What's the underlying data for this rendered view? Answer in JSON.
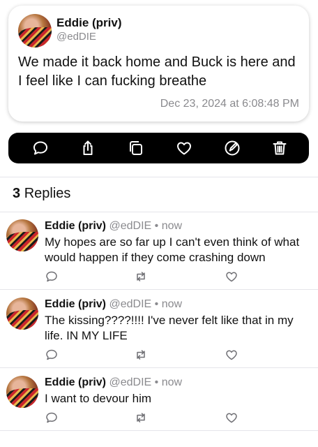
{
  "post": {
    "author_name": "Eddie (priv)",
    "author_handle": "@edDIE",
    "text": "We made it back home and Buck is here and I feel like I can fucking breathe",
    "timestamp": "Dec 23, 2024 at 6:08:48 PM"
  },
  "actionbar": {
    "icons": [
      "comment-icon",
      "share-icon",
      "copy-icon",
      "like-icon",
      "edit-icon",
      "trash-icon"
    ]
  },
  "replies_header": {
    "count": "3",
    "label": "Replies"
  },
  "replies": [
    {
      "author_name": "Eddie (priv)",
      "author_handle": "@edDIE",
      "separator": "•",
      "time": "now",
      "text": "My hopes are so far up I can't even think of what would happen if they come crashing down"
    },
    {
      "author_name": "Eddie (priv)",
      "author_handle": "@edDIE",
      "separator": "•",
      "time": "now",
      "text": "The kissing????!!!! I've never felt like that in my life. IN MY LIFE"
    },
    {
      "author_name": "Eddie (priv)",
      "author_handle": "@edDIE",
      "separator": "•",
      "time": "now",
      "text": "I want to devour him"
    }
  ],
  "colors": {
    "accent_dark": "#000000",
    "secondary_text": "#8a8a8e",
    "icon_gray": "#6e6e73"
  }
}
